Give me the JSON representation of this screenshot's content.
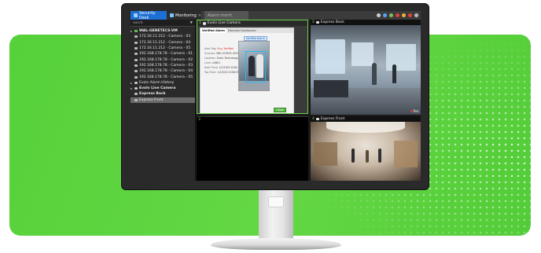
{
  "titlebar": {
    "app_tab": "Security Desk",
    "monitoring_tab": "Monitoring",
    "alarm_tab": "Alarm monit.",
    "close_glyph": "×"
  },
  "sidebar": {
    "search_label": "earch",
    "items": [
      {
        "label": "WAL-GENETECS-VM",
        "kind": "group",
        "bold": true
      },
      {
        "label": "172.16.11.212 - Camera - 03",
        "kind": "camera"
      },
      {
        "label": "172.16.11.212 - Camera - 04",
        "kind": "camera"
      },
      {
        "label": "172.16.11.212 - Camera - 05",
        "kind": "camera"
      },
      {
        "label": "192.168.178.78 - Camera - 01",
        "kind": "camera"
      },
      {
        "label": "192.168.178.78 - Camera - 02",
        "kind": "camera"
      },
      {
        "label": "192.168.178.78 - Camera - 03",
        "kind": "camera"
      },
      {
        "label": "192.168.178.78 - Camera - 04",
        "kind": "camera"
      },
      {
        "label": "192.168.178.78 - Camera - 05",
        "kind": "camera"
      },
      {
        "label": "Evolv Alarm History",
        "kind": "alarm"
      },
      {
        "label": "Evolv Live Camera",
        "kind": "alarm",
        "bold": true
      },
      {
        "label": "Express Back",
        "kind": "plain",
        "bold": true
      },
      {
        "label": "Express Front",
        "kind": "plain",
        "selected": true
      }
    ]
  },
  "tiles": {
    "t1": {
      "number": "1",
      "title": "Evolv Live Camera",
      "dialog": {
        "tabs": [
          "Verified Alarm",
          "Modules Dashboard"
        ],
        "verified_button": "Verified Alarm",
        "fields": [
          {
            "key": "Alert Tag:",
            "value": "Gun, Verified",
            "red": true
          },
          {
            "key": "Scanner:",
            "value": "SBS-103E03-0534"
          },
          {
            "key": "Location:",
            "value": "Evolv Technology - WAL - HQ"
          },
          {
            "key": "Lane:",
            "value": "LANE1"
          },
          {
            "key": "Alert Time:",
            "value": "1/1/2022 8:08:34 AM"
          },
          {
            "key": "Tag Time:",
            "value": "1/1/2022 8:08:35 AM"
          }
        ],
        "close_button": "Close"
      }
    },
    "t2": {
      "number": "2",
      "title": "Express Back",
      "rec_label": "Rec"
    },
    "t3": {
      "number": "3"
    },
    "t4": {
      "number": "4",
      "title": "Express Front"
    }
  },
  "icons": {
    "filter": "funnel-icon",
    "camera": "camera-icon",
    "alarm": "alarm-icon"
  },
  "colors": {
    "accent_green": "#5bd13c",
    "app_tab_blue": "#1d6fd4",
    "alert_red": "#d22222"
  }
}
